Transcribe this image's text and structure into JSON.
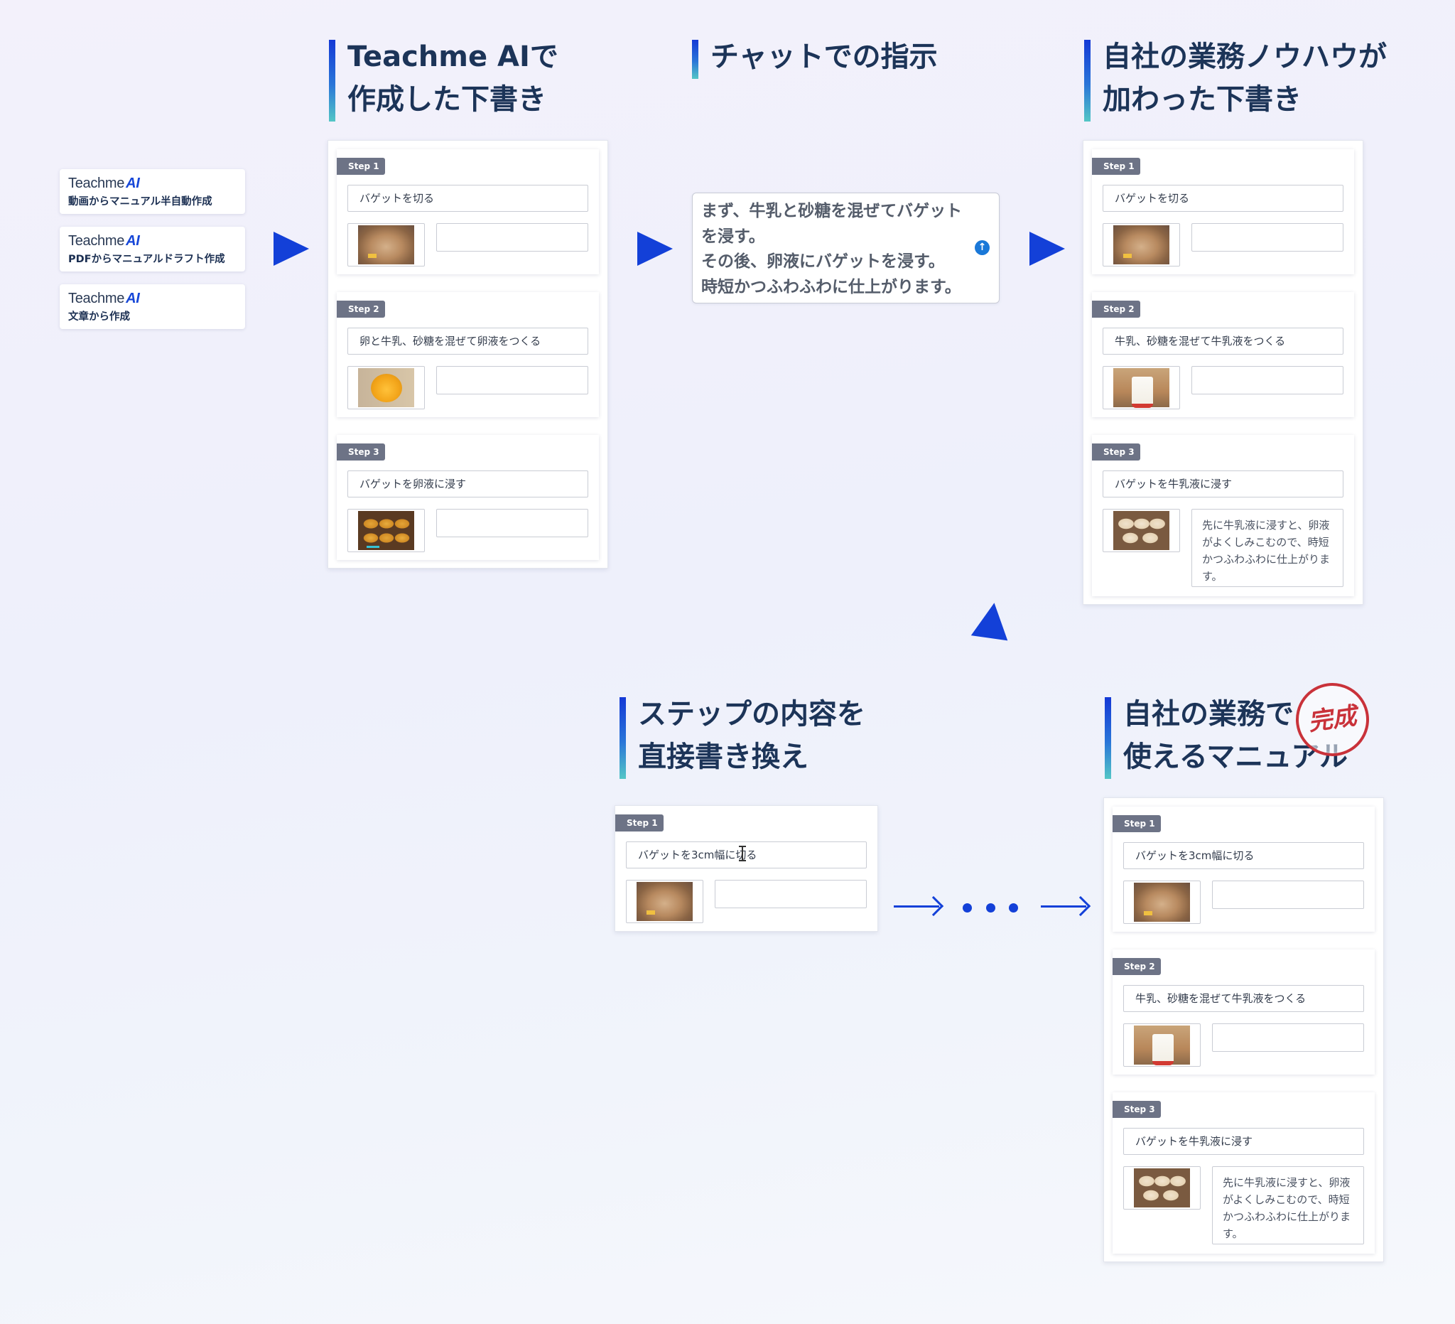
{
  "sources": [
    {
      "brand": "Teachme",
      "brand_ai": "AI",
      "label": "動画からマニュアル半自動作成"
    },
    {
      "brand": "Teachme",
      "brand_ai": "AI",
      "label": "PDFからマニュアルドラフト作成"
    },
    {
      "brand": "Teachme",
      "brand_ai": "AI",
      "label": "文章から作成"
    }
  ],
  "headings": {
    "draft": [
      "Teachme AIで",
      "作成した下書き"
    ],
    "chat": [
      "チャットでの指示"
    ],
    "knowhow": [
      "自社の業務ノウハウが",
      "加わった下書き"
    ],
    "edit": [
      "ステップの内容を",
      "直接書き換え"
    ],
    "final": [
      "自社の業務で",
      "使えるマニュアル"
    ]
  },
  "stamp_text": "完成",
  "chat": {
    "lines": [
      "まず、牛乳と砂糖を混ぜてバゲット",
      "を浸す。",
      "その後、卵液にバゲットを浸す。",
      "時短かつふわふわに仕上がります。"
    ],
    "send_icon": "arrow-up-icon"
  },
  "draft_steps": [
    {
      "badge": "Step 1",
      "title": "バゲットを切る",
      "desc": ""
    },
    {
      "badge": "Step 2",
      "title": "卵と牛乳、砂糖を混ぜて卵液をつくる",
      "desc": ""
    },
    {
      "badge": "Step 3",
      "title": "バゲットを卵液に浸す",
      "desc": ""
    }
  ],
  "knowhow_steps": [
    {
      "badge": "Step 1",
      "title": "バゲットを切る",
      "desc": ""
    },
    {
      "badge": "Step 2",
      "title": "牛乳、砂糖を混ぜて牛乳液をつくる",
      "desc": ""
    },
    {
      "badge": "Step 3",
      "title": "バゲットを牛乳液に浸す",
      "desc": "先に牛乳液に浸すと、卵液がよくしみこむので、時短かつふわふわに仕上がります。"
    }
  ],
  "edit_step": {
    "badge": "Step 1",
    "title": "バゲットを3cm幅に切る",
    "desc": ""
  },
  "final_steps": [
    {
      "badge": "Step 1",
      "title": "バゲットを3cm幅に切る",
      "desc": ""
    },
    {
      "badge": "Step 2",
      "title": "牛乳、砂糖を混ぜて牛乳液をつくる",
      "desc": ""
    },
    {
      "badge": "Step 3",
      "title": "バゲットを牛乳液に浸す",
      "desc": "先に牛乳液に浸すと、卵液がよくしみこむので、時短かつふわふわに仕上がります。"
    }
  ],
  "colors": {
    "accent": "#1340d8",
    "heading": "#1c3458",
    "stamp": "#c9323a",
    "badge": "#6d7386"
  }
}
